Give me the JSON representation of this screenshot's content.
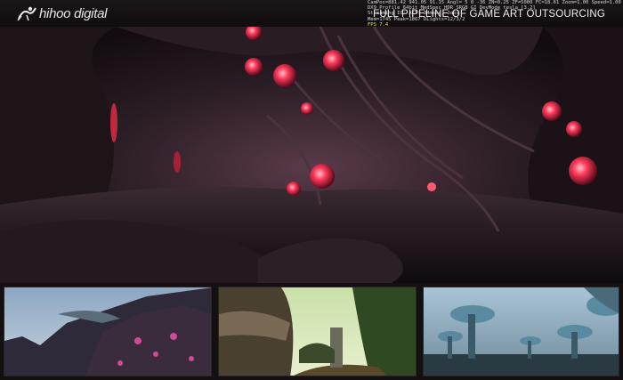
{
  "header": {
    "logo_text": "hihoo digital",
    "tagline": "FULL PIPELINE OF GAME ART OUTSOURCING",
    "debug_overlay": {
      "line1": "CamPos=881.42 941.05 91.15 Angl= 5 0 -36 ZN=0.25 ZF=5000 FC=18.61 Zoom=1.00 Speed=1.00",
      "line2": "DX9 Profile 64bit MedSpec HDR SRGB GI DevMode tesla [3.2]",
      "line3": "Streaming IO: ACT: 34msec, Jobs",
      "line4": "Mem=1745 Peak=1867 DLights=12/3/2",
      "fps_label": "FPS",
      "fps_value": "7.4"
    }
  },
  "scene": {
    "hero_alt": "Alien cave with glowing red organic pods and twisted roots",
    "thumbnails": [
      {
        "name": "crystal-cliffs-scene",
        "alt": "Rocky cliffs with pink crystal formations under blue sky"
      },
      {
        "name": "forest-ruins-scene",
        "alt": "Sunlit jungle with ancient stone ruins"
      },
      {
        "name": "mushroom-forest-scene",
        "alt": "Misty forest of giant blue mushrooms"
      }
    ]
  },
  "colors": {
    "background": "#141012",
    "pod_glow": "#ff3a5a",
    "fps_yellow": "#e4e81a"
  }
}
